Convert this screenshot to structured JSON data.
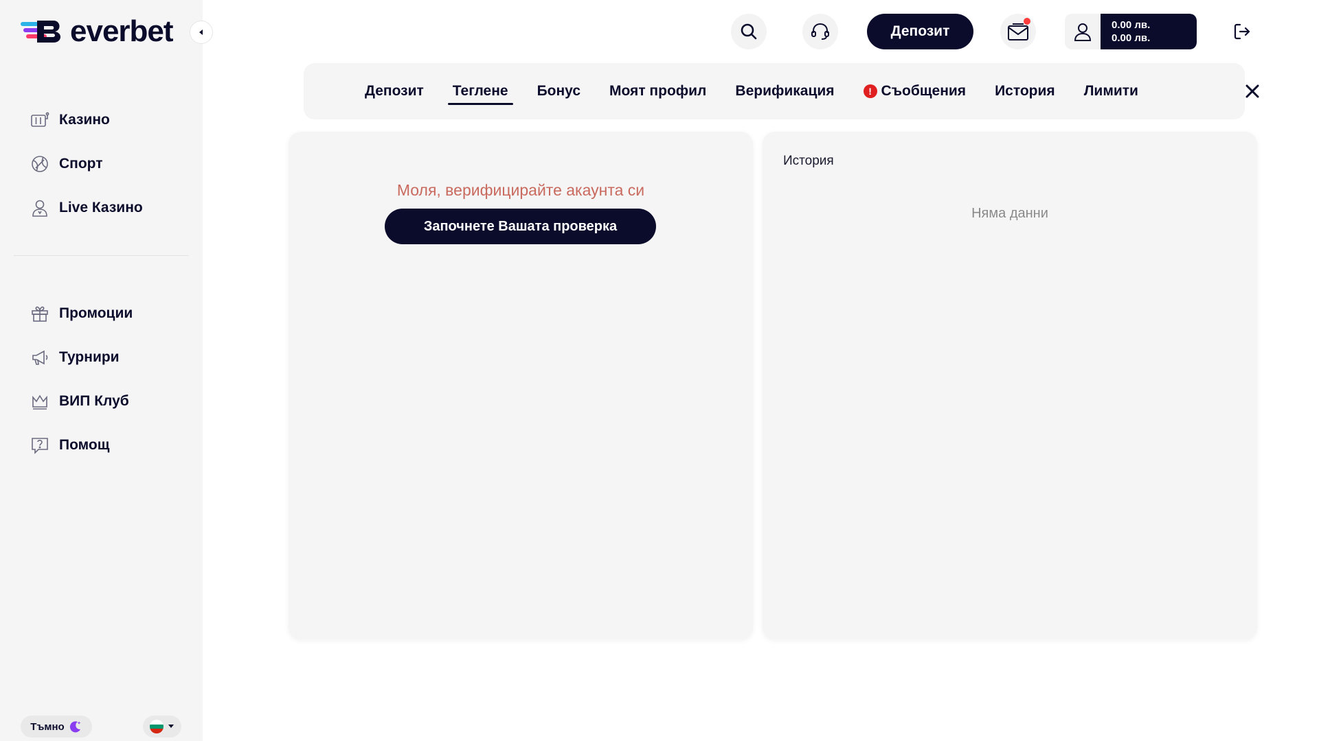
{
  "brand": {
    "name": "everbet"
  },
  "sidebar": {
    "main_items": [
      {
        "label": "Казино",
        "icon": "slot-machine-icon"
      },
      {
        "label": "Спорт",
        "icon": "ball-icon"
      },
      {
        "label": "Live Казино",
        "icon": "dealer-icon"
      }
    ],
    "secondary_items": [
      {
        "label": "Промоции",
        "icon": "gift-icon"
      },
      {
        "label": "Турнири",
        "icon": "megaphone-icon"
      },
      {
        "label": "ВИП Клуб",
        "icon": "crown-icon"
      },
      {
        "label": "Помощ",
        "icon": "help-icon"
      }
    ],
    "theme_label": "Тъмно",
    "language": "BG"
  },
  "header": {
    "deposit_label": "Депозит",
    "balance_main": "0.00 лв.",
    "balance_bonus": "0.00 лв."
  },
  "tabs": [
    {
      "label": "Депозит",
      "active": false,
      "warning": false
    },
    {
      "label": "Теглене",
      "active": true,
      "warning": false
    },
    {
      "label": "Бонус",
      "active": false,
      "warning": false
    },
    {
      "label": "Моят профил",
      "active": false,
      "warning": false
    },
    {
      "label": "Верификация",
      "active": false,
      "warning": false
    },
    {
      "label": "Съобщения",
      "active": false,
      "warning": true
    },
    {
      "label": "История",
      "active": false,
      "warning": false
    },
    {
      "label": "Лимити",
      "active": false,
      "warning": false
    }
  ],
  "withdraw": {
    "message": "Моля, верифицирайте акаунта си",
    "button_label": "Започнете Вашата проверка"
  },
  "history": {
    "title": "История",
    "empty_text": "Няма данни"
  },
  "colors": {
    "primary": "#0b0b2c",
    "panel_bg": "#f5f5f5",
    "warning_text": "#c96a5e",
    "alert": "#e02020"
  }
}
